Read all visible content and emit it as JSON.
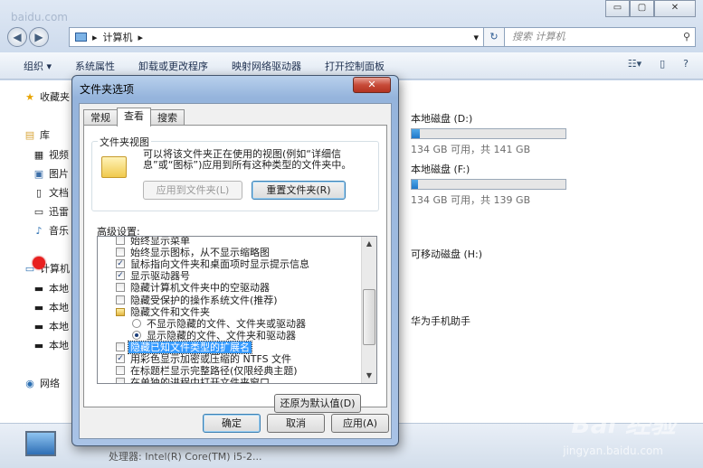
{
  "explorer": {
    "address": {
      "separator_arrow": "▸",
      "path": "计算机",
      "trailing_arrow": "▸"
    },
    "search_placeholder": "搜索 计算机",
    "window_buttons": {
      "minimize": "▭",
      "maximize": "▢",
      "close": "✕"
    },
    "toolbar": [
      "组织 ▾",
      "系统属性",
      "卸载或更改程序",
      "映射网络驱动器",
      "打开控制面板"
    ],
    "nav": {
      "favorites": "收藏夹",
      "library": "库",
      "videos": "视频",
      "pictures": "图片",
      "documents": "文档",
      "thunder": "迅雷",
      "music": "音乐",
      "computer": "计算机",
      "local1": "本地",
      "local2": "本地",
      "local3": "本地",
      "local4": "本地",
      "network": "网络"
    },
    "drives": [
      {
        "name": "本地磁盘 (D:)",
        "free": "134 GB 可用，共 141 GB",
        "used_fraction": 0.05
      },
      {
        "name": "本地磁盘 (F:)",
        "free": "134 GB 可用，共 139 GB",
        "used_fraction": 0.04
      }
    ],
    "removable": "可移动磁盘 (H:)",
    "phone": "华为手机助手",
    "status_text": "处理器: Intel(R) Core(TM) i5-2...",
    "watermark": "Bai 经验",
    "watermark_sub": "jingyan.baidu.com",
    "blur_title": "baidu.com"
  },
  "dialog": {
    "title": "文件夹选项",
    "close_label": "✕",
    "tabs": [
      "常规",
      "查看",
      "搜索"
    ],
    "active_tab": 1,
    "folder_view": {
      "group_label": "文件夹视图",
      "description": "可以将该文件夹正在使用的视图(例如“详细信息”或“图标”)应用到所有这种类型的文件夹中。",
      "apply_button": "应用到文件夹(L)",
      "reset_button": "重置文件夹(R)"
    },
    "advanced_label": "高级设置:",
    "tree": [
      {
        "kind": "check",
        "checked": false,
        "indent": 1,
        "label": "始终显示菜单"
      },
      {
        "kind": "check",
        "checked": false,
        "indent": 1,
        "label": "始终显示图标，从不显示缩略图"
      },
      {
        "kind": "check",
        "checked": true,
        "indent": 1,
        "label": "鼠标指向文件夹和桌面项时显示提示信息"
      },
      {
        "kind": "check",
        "checked": true,
        "indent": 1,
        "label": "显示驱动器号"
      },
      {
        "kind": "check",
        "checked": false,
        "indent": 1,
        "label": "隐藏计算机文件夹中的空驱动器"
      },
      {
        "kind": "check",
        "checked": false,
        "indent": 1,
        "label": "隐藏受保护的操作系统文件(推荐)"
      },
      {
        "kind": "folder",
        "checked": false,
        "indent": 1,
        "label": "隐藏文件和文件夹"
      },
      {
        "kind": "radio",
        "checked": false,
        "indent": 2,
        "label": "不显示隐藏的文件、文件夹或驱动器"
      },
      {
        "kind": "radio",
        "checked": true,
        "indent": 2,
        "label": "显示隐藏的文件、文件夹和驱动器"
      },
      {
        "kind": "check",
        "checked": false,
        "indent": 1,
        "label": "隐藏已知文件类型的扩展名",
        "selected": true
      },
      {
        "kind": "check",
        "checked": true,
        "indent": 1,
        "label": "用彩色显示加密或压缩的 NTFS 文件"
      },
      {
        "kind": "check",
        "checked": false,
        "indent": 1,
        "label": "在标题栏显示完整路径(仅限经典主题)"
      },
      {
        "kind": "check",
        "checked": false,
        "indent": 1,
        "label": "在单独的进程中打开文件夹窗口"
      }
    ],
    "restore_defaults": "还原为默认值(D)",
    "ok": "确定",
    "cancel": "取消",
    "apply": "应用(A)"
  }
}
